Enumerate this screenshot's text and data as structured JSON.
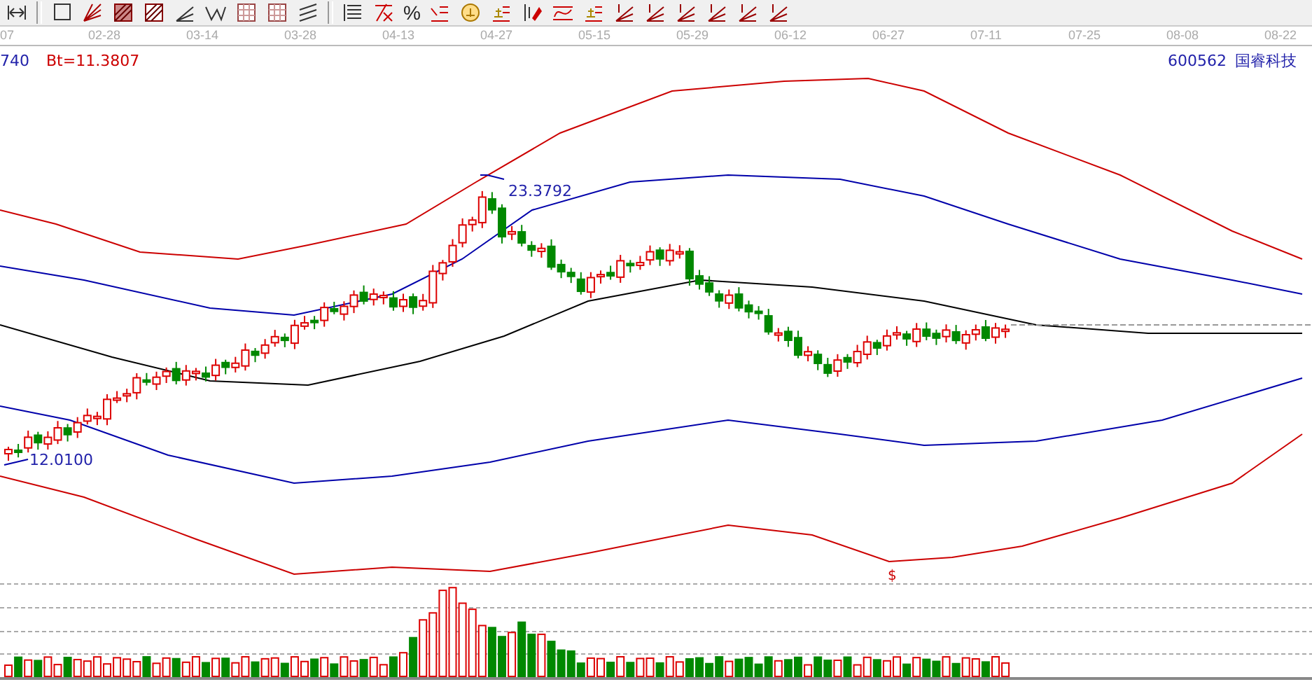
{
  "toolbar": {
    "percent_button": "%"
  },
  "date_axis": [
    "07",
    "02-28",
    "03-14",
    "03-28",
    "04-13",
    "04-27",
    "05-15",
    "05-29",
    "06-12",
    "06-27",
    "07-11",
    "07-25",
    "08-08",
    "08-22"
  ],
  "header": {
    "indicator_value": "740",
    "indicator_reading": "Bt=11.3807",
    "stock_code": "600562",
    "stock_name": "国睿科技"
  },
  "annotations": {
    "high_label": "23.3792",
    "low_label": "12.0100",
    "marker": "$"
  }
}
